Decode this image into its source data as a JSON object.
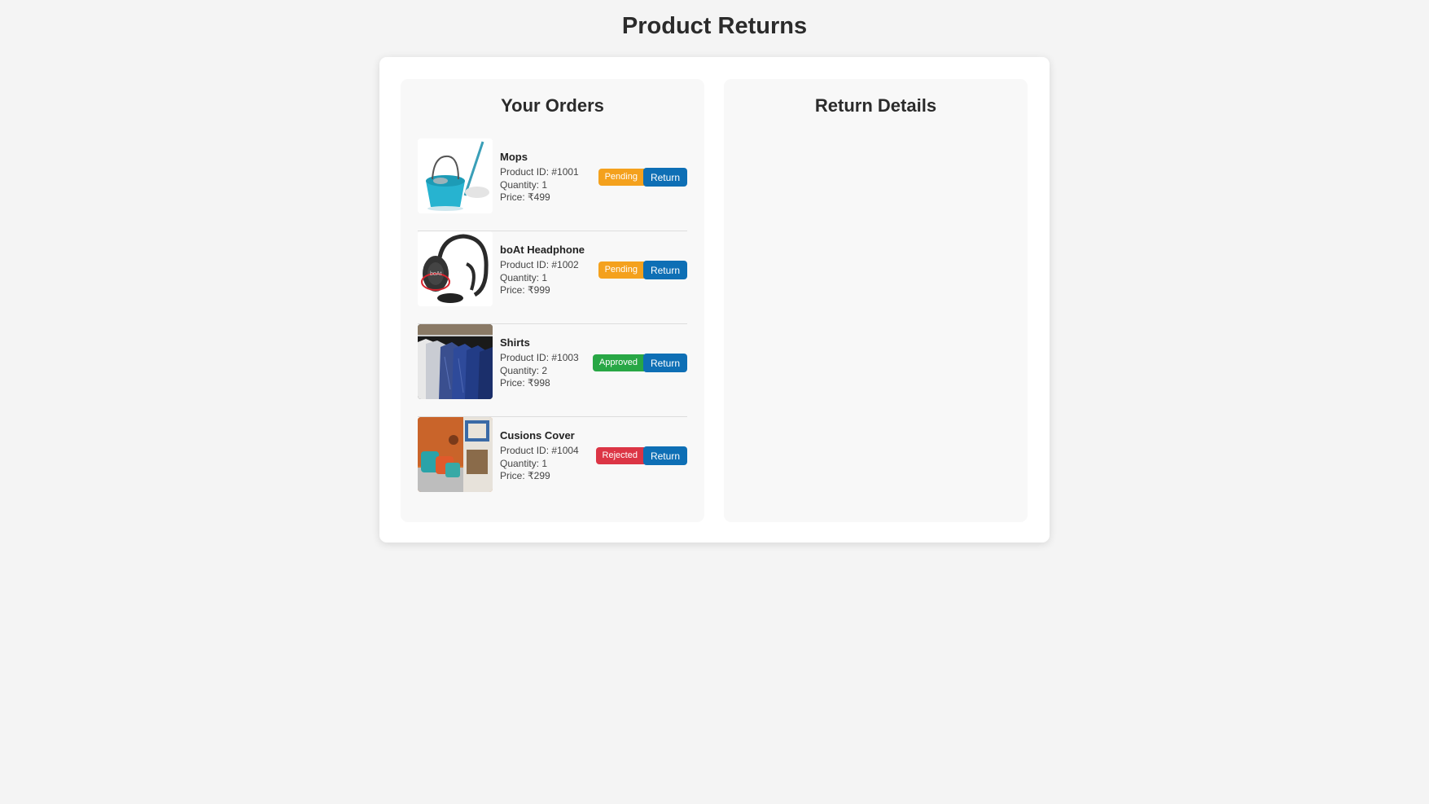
{
  "page": {
    "title": "Product Returns"
  },
  "orders_panel": {
    "title": "Your Orders"
  },
  "details_panel": {
    "title": "Return Details"
  },
  "status_colors": {
    "Pending": "#f4a11d",
    "Approved": "#28a745",
    "Rejected": "#dc3545"
  },
  "accent": "#0e6fb5",
  "orders": [
    {
      "name": "Mops",
      "product_id": "Product ID: #1001",
      "quantity": "Quantity: 1",
      "price": "Price: ₹499",
      "status": "Pending",
      "action": "Return",
      "image": "mop-bucket-image"
    },
    {
      "name": "boAt Headphone",
      "product_id": "Product ID: #1002",
      "quantity": "Quantity: 1",
      "price": "Price: ₹999",
      "status": "Pending",
      "action": "Return",
      "image": "headphone-image"
    },
    {
      "name": "Shirts",
      "product_id": "Product ID: #1003",
      "quantity": "Quantity: 2",
      "price": "Price: ₹998",
      "status": "Approved",
      "action": "Return",
      "image": "shirts-rack-image"
    },
    {
      "name": "Cusions Cover",
      "product_id": "Product ID: #1004",
      "quantity": "Quantity: 1",
      "price": "Price: ₹299",
      "status": "Rejected",
      "action": "Return",
      "image": "cushion-cover-image"
    }
  ]
}
